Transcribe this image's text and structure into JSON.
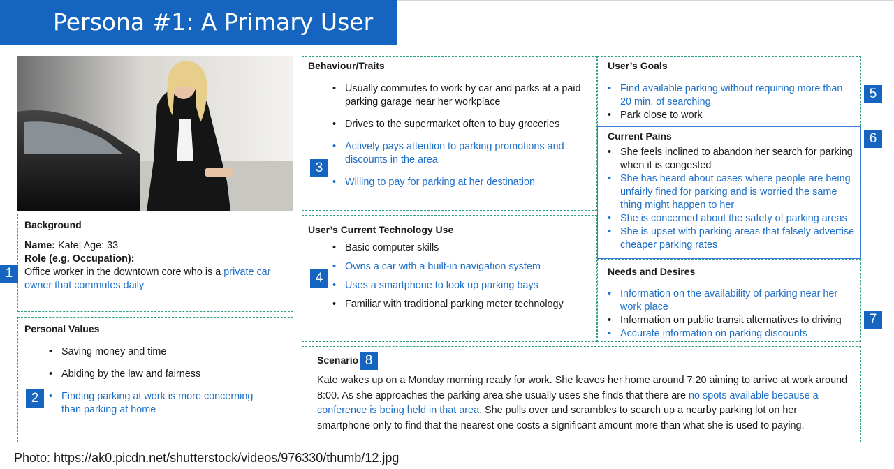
{
  "title": "Persona #1: A Primary User",
  "background": {
    "heading": "Background",
    "name_label": "Name:",
    "name_value": " Kate| Age: 33",
    "role_label": "Role (e.g. Occupation):",
    "role_text": "Office worker in the downtown core who is a ",
    "role_highlight": "private car owner that commutes daily"
  },
  "values": {
    "heading": "Personal Values",
    "items": [
      {
        "text": "Saving money and time",
        "highlight": false
      },
      {
        "text": "Abiding by the law and fairness",
        "highlight": false
      },
      {
        "text": "Finding parking at work is more concerning than parking at home",
        "highlight": true
      }
    ]
  },
  "behaviour": {
    "heading": "Behaviour/Traits",
    "items": [
      {
        "text": "Usually commutes to work by car and parks at a paid parking garage near her workplace",
        "highlight": false
      },
      {
        "text": "Drives to the supermarket often to buy groceries",
        "highlight": false
      },
      {
        "text": "Actively pays attention to parking promotions and discounts in the area",
        "highlight": true
      },
      {
        "text": "Willing to pay for parking at her destination",
        "highlight": true
      }
    ]
  },
  "technology": {
    "heading": "User’s Current Technology Use",
    "items": [
      {
        "text": "Basic computer skills",
        "highlight": false
      },
      {
        "text": "Owns a car with a built-in navigation system",
        "highlight": true
      },
      {
        "text": "Uses a smartphone to look up parking bays",
        "highlight": true
      },
      {
        "text": "Familiar with traditional parking meter technology",
        "highlight": false
      }
    ]
  },
  "goals": {
    "heading": "User’s Goals",
    "items": [
      {
        "text": "Find available parking without requiring more than 20 min. of searching",
        "highlight": true
      },
      {
        "text": "Park close to work",
        "highlight": false
      }
    ]
  },
  "pains": {
    "heading": "Current Pains",
    "items": [
      {
        "text": "She feels inclined to abandon her search for parking when it is congested",
        "highlight": false
      },
      {
        "text": "She has heard about cases where people are being unfairly fined for parking and is worried the same thing might happen to her",
        "highlight": true
      },
      {
        "text": "She is concerned about the safety of parking areas",
        "highlight": true
      },
      {
        "text": "She is upset with parking areas that falsely advertise cheaper parking rates",
        "highlight": true
      }
    ]
  },
  "needs": {
    "heading": "Needs and Desires",
    "items": [
      {
        "text": "Information on the availability of parking near her work place",
        "highlight": true
      },
      {
        "text": "Information on public transit alternatives to driving",
        "highlight": false
      },
      {
        "text": "Accurate information on parking discounts",
        "highlight": true
      }
    ]
  },
  "scenario": {
    "heading": "Scenario",
    "text_1": "Kate wakes up on a Monday morning ready for work. She leaves her home around 7:20 aiming to arrive at work around 8:00. As she approaches the parking area she usually uses she finds that there are ",
    "text_highlight": "no spots available because a conference is being held in that area.",
    "text_2": " She pulls over and scrambles to search up a nearby parking lot on her smartphone only to find that the nearest one costs a significant amount more than what she is used to paying."
  },
  "badges": [
    "1",
    "2",
    "3",
    "4",
    "5",
    "6",
    "7",
    "8"
  ],
  "caption": "Photo: https://ak0.picdn.net/shutterstock/videos/976330/thumb/12.jpg",
  "colors": {
    "accent": "#1565c0",
    "highlight": "#1e6fc8",
    "border": "#2e9e88"
  }
}
